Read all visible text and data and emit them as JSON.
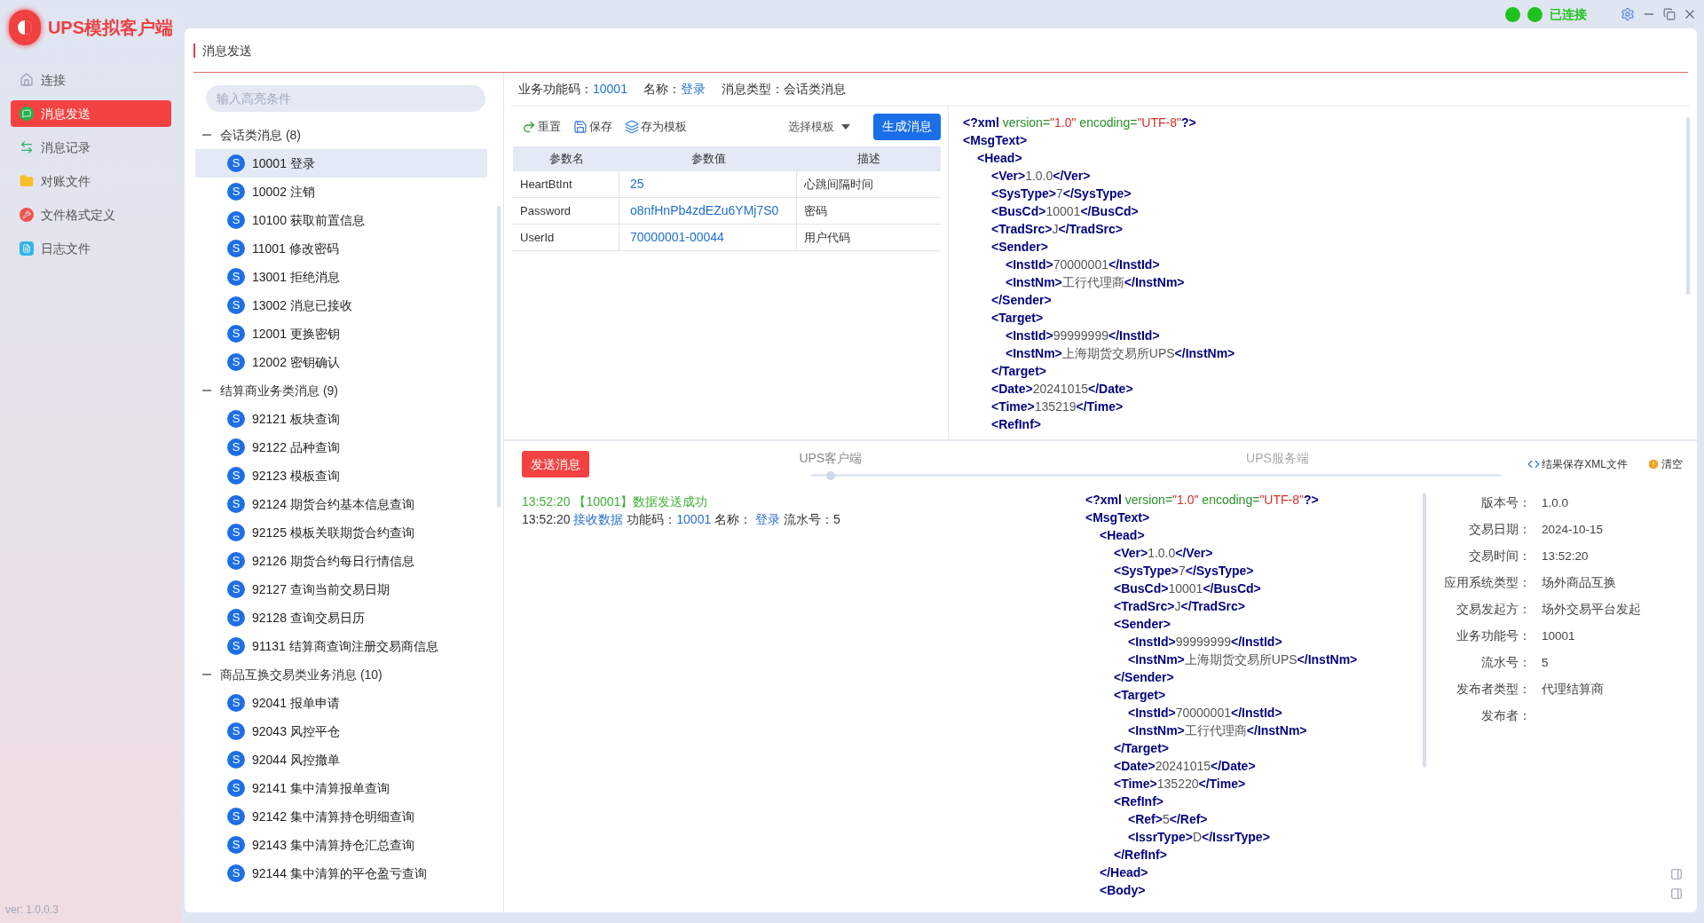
{
  "app": {
    "title": "UPS模拟客户端",
    "version": "ver: 1.0.0.3"
  },
  "status": {
    "text": "已连接",
    "connected": true
  },
  "nav": [
    {
      "label": "连接",
      "selected": false
    },
    {
      "label": "消息发送",
      "selected": true
    },
    {
      "label": "消息记录",
      "selected": false
    },
    {
      "label": "对账文件",
      "selected": false
    },
    {
      "label": "文件格式定义",
      "selected": false
    },
    {
      "label": "日志文件",
      "selected": false
    }
  ],
  "page_title": "消息发送",
  "search": {
    "placeholder": "输入高亮条件"
  },
  "tree": [
    {
      "label": "会话类消息 (8)",
      "expanded": true,
      "children": [
        {
          "badge": "S",
          "label": "10001 登录",
          "selected": true
        },
        {
          "badge": "S",
          "label": "10002 注销",
          "selected": false
        },
        {
          "badge": "S",
          "label": "10100 获取前置信息",
          "selected": false
        },
        {
          "badge": "S",
          "label": "11001 修改密码",
          "selected": false
        },
        {
          "badge": "S",
          "label": "13001 拒绝消息",
          "selected": false
        },
        {
          "badge": "S",
          "label": "13002 消息已接收",
          "selected": false
        },
        {
          "badge": "S",
          "label": "12001 更换密钥",
          "selected": false
        },
        {
          "badge": "S",
          "label": "12002 密钥确认",
          "selected": false
        }
      ]
    },
    {
      "label": "结算商业务类消息 (9)",
      "expanded": true,
      "children": [
        {
          "badge": "S",
          "label": "92121 板块查询",
          "selected": false
        },
        {
          "badge": "S",
          "label": "92122 品种查询",
          "selected": false
        },
        {
          "badge": "S",
          "label": "92123 模板查询",
          "selected": false
        },
        {
          "badge": "S",
          "label": "92124 期货合约基本信息查询",
          "selected": false
        },
        {
          "badge": "S",
          "label": "92125 模板关联期货合约查询",
          "selected": false
        },
        {
          "badge": "S",
          "label": "92126 期货合约每日行情信息",
          "selected": false
        },
        {
          "badge": "S",
          "label": "92127 查询当前交易日期",
          "selected": false
        },
        {
          "badge": "S",
          "label": "92128 查询交易日历",
          "selected": false
        },
        {
          "badge": "S",
          "label": "91131 结算商查询注册交易商信息",
          "selected": false
        }
      ]
    },
    {
      "label": "商品互换交易类业务消息 (10)",
      "expanded": true,
      "children": [
        {
          "badge": "S",
          "label": "92041 报单申请",
          "selected": false
        },
        {
          "badge": "S",
          "label": "92043 风控平仓",
          "selected": false
        },
        {
          "badge": "S",
          "label": "92044 风控撤单",
          "selected": false
        },
        {
          "badge": "S",
          "label": "92141 集中清算报单查询",
          "selected": false
        },
        {
          "badge": "S",
          "label": "92142 集中清算持仓明细查询",
          "selected": false
        },
        {
          "badge": "S",
          "label": "92143 集中清算持仓汇总查询",
          "selected": false
        },
        {
          "badge": "S",
          "label": "92144 集中清算的平仓盈亏查询",
          "selected": false
        }
      ]
    }
  ],
  "message_info": [
    {
      "label": "业务功能码：",
      "value": "10001",
      "kind": "link"
    },
    {
      "label": "名称：",
      "value": "登录",
      "kind": "link"
    },
    {
      "label": "消息类型：",
      "value": "会话类消息",
      "kind": "plain"
    }
  ],
  "toolbar": [
    "重置",
    "保存",
    "存为模板"
  ],
  "template_select": {
    "label": "选择模板"
  },
  "generate_button": "生成消息",
  "params": {
    "columns": [
      "参数名",
      "参数值",
      "描述"
    ],
    "rows": [
      {
        "name": "HeartBtInt",
        "value": "25",
        "description": "心跳间隔时间"
      },
      {
        "name": "Password",
        "value": "o8nfHnPb4zdEZu6YMj7S0",
        "description": "密码"
      },
      {
        "name": "UserId",
        "value": "70000001-00044",
        "description": "用户代码"
      }
    ]
  },
  "request_xml": {
    "declaration": [
      {
        "kind": "tag",
        "text": "<?xml"
      },
      {
        "kind": "attr",
        "text": " version="
      },
      {
        "kind": "string",
        "text": "\"1.0\""
      },
      {
        "kind": "attr",
        "text": " encoding="
      },
      {
        "kind": "string",
        "text": "\"UTF-8\""
      },
      {
        "kind": "tag",
        "text": "?>"
      }
    ],
    "root": {
      "open": "<MsgText>",
      "children": [
        {
          "open": "<Head>",
          "children": [
            {
              "open": "<Ver>",
              "value": "1.0.0",
              "close": "</Ver>"
            },
            {
              "open": "<SysType>",
              "value": "7",
              "close": "</SysType>"
            },
            {
              "open": "<BusCd>",
              "value": "10001",
              "close": "</BusCd>"
            },
            {
              "open": "<TradSrc>",
              "value": "J",
              "close": "</TradSrc>"
            },
            {
              "open": "<Sender>",
              "close": "</Sender>",
              "children": [
                {
                  "open": "<InstId>",
                  "value": "70000001",
                  "close": "</InstId>"
                },
                {
                  "open": "<InstNm>",
                  "value": "工行代理商",
                  "close": "</InstNm>"
                }
              ]
            },
            {
              "open": "<Target>",
              "close": "</Target>",
              "children": [
                {
                  "open": "<InstId>",
                  "value": "99999999",
                  "close": "</InstId>"
                },
                {
                  "open": "<InstNm>",
                  "value": "上海期货交易所UPS",
                  "close": "</InstNm>"
                }
              ]
            },
            {
              "open": "<Date>",
              "value": "20241015",
              "close": "</Date>"
            },
            {
              "open": "<Time>",
              "value": "135219",
              "close": "</Time>"
            },
            {
              "open": "<RefInf>"
            }
          ]
        }
      ]
    }
  },
  "send_button": "发送消息",
  "channels": [
    {
      "label": "UPS客户端",
      "selected": true
    },
    {
      "label": "UPS服务端",
      "selected": false
    }
  ],
  "result_actions": [
    "结果保存XML文件",
    "清空"
  ],
  "log": [
    {
      "kind": "success",
      "text": "13:52:20 【10001】数据发送成功"
    },
    {
      "kind": "detail",
      "time": "13:52:20",
      "action": "接收数据",
      "code_label": "功能码：",
      "code": "10001",
      "name_label": "名称：",
      "name": "登录",
      "serial_label": "流水号：",
      "serial": "5"
    }
  ],
  "response_xml": {
    "declaration": [
      {
        "kind": "tag",
        "text": "<?xml"
      },
      {
        "kind": "attr",
        "text": " version="
      },
      {
        "kind": "string",
        "text": "\"1.0\""
      },
      {
        "kind": "attr",
        "text": " encoding="
      },
      {
        "kind": "string",
        "text": "\"UTF-8\""
      },
      {
        "kind": "tag",
        "text": "?>"
      }
    ],
    "root": {
      "open": "<MsgText>",
      "children": [
        {
          "open": "<Head>",
          "close": "</Head>",
          "children": [
            {
              "open": "<Ver>",
              "value": "1.0.0",
              "close": "</Ver>"
            },
            {
              "open": "<SysType>",
              "value": "7",
              "close": "</SysType>"
            },
            {
              "open": "<BusCd>",
              "value": "10001",
              "close": "</BusCd>"
            },
            {
              "open": "<TradSrc>",
              "value": "J",
              "close": "</TradSrc>"
            },
            {
              "open": "<Sender>",
              "close": "</Sender>",
              "children": [
                {
                  "open": "<InstId>",
                  "value": "99999999",
                  "close": "</InstId>"
                },
                {
                  "open": "<InstNm>",
                  "value": "上海期货交易所UPS",
                  "close": "</InstNm>"
                }
              ]
            },
            {
              "open": "<Target>",
              "close": "</Target>",
              "children": [
                {
                  "open": "<InstId>",
                  "value": "70000001",
                  "close": "</InstId>"
                },
                {
                  "open": "<InstNm>",
                  "value": "工行代理商",
                  "close": "</InstNm>"
                }
              ]
            },
            {
              "open": "<Date>",
              "value": "20241015",
              "close": "</Date>"
            },
            {
              "open": "<Time>",
              "value": "135220",
              "close": "</Time>"
            },
            {
              "open": "<RefInf>",
              "close": "</RefInf>",
              "children": [
                {
                  "open": "<Ref>",
                  "value": "5",
                  "close": "</Ref>"
                },
                {
                  "open": "<IssrType>",
                  "value": "D",
                  "close": "</IssrType>"
                }
              ]
            }
          ]
        },
        {
          "open": "<Body>"
        }
      ]
    }
  },
  "details": [
    {
      "label": "版本号：",
      "value": "1.0.0"
    },
    {
      "label": "交易日期：",
      "value": "2024-10-15"
    },
    {
      "label": "交易时间：",
      "value": "13:52:20"
    },
    {
      "label": "应用系统类型：",
      "value": "场外商品互换"
    },
    {
      "label": "交易发起方：",
      "value": "场外交易平台发起"
    },
    {
      "label": "业务功能号：",
      "value": "10001"
    },
    {
      "label": "流水号：",
      "value": "5"
    },
    {
      "label": "发布者类型：",
      "value": "代理结算商"
    },
    {
      "label": "发布者："
    }
  ]
}
